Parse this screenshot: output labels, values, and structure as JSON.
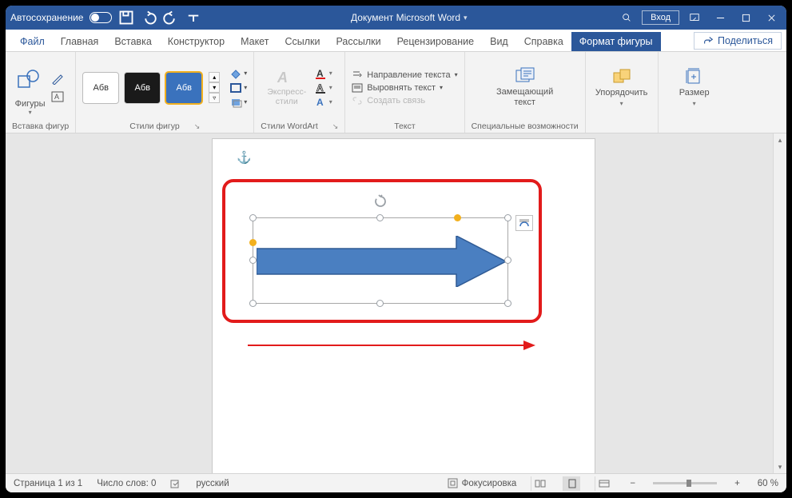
{
  "titlebar": {
    "autosave": "Автосохранение",
    "doc_title": "Документ Microsoft Word",
    "login": "Вход"
  },
  "tabs": {
    "file": "Файл",
    "home": "Главная",
    "insert": "Вставка",
    "design": "Конструктор",
    "layout": "Макет",
    "references": "Ссылки",
    "mailings": "Рассылки",
    "review": "Рецензирование",
    "view": "Вид",
    "help": "Справка",
    "shape_format": "Формат фигуры",
    "share": "Поделиться"
  },
  "ribbon": {
    "insert_shapes": {
      "shapes": "Фигуры",
      "group": "Вставка фигур"
    },
    "shape_styles": {
      "sample": "Абв",
      "group": "Стили фигур"
    },
    "wordart": {
      "express": "Экспресс-\nстили",
      "group": "Стили WordArt"
    },
    "text": {
      "direction": "Направление текста",
      "align": "Выровнять текст",
      "link": "Создать связь",
      "group": "Текст"
    },
    "access": {
      "alt": "Замещающий\nтекст",
      "group": "Специальные возможности"
    },
    "arrange": {
      "label": "Упорядочить"
    },
    "size": {
      "label": "Размер"
    }
  },
  "status": {
    "page": "Страница 1 из 1",
    "words": "Число слов: 0",
    "lang": "русский",
    "focus": "Фокусировка",
    "zoom": "60 %"
  }
}
